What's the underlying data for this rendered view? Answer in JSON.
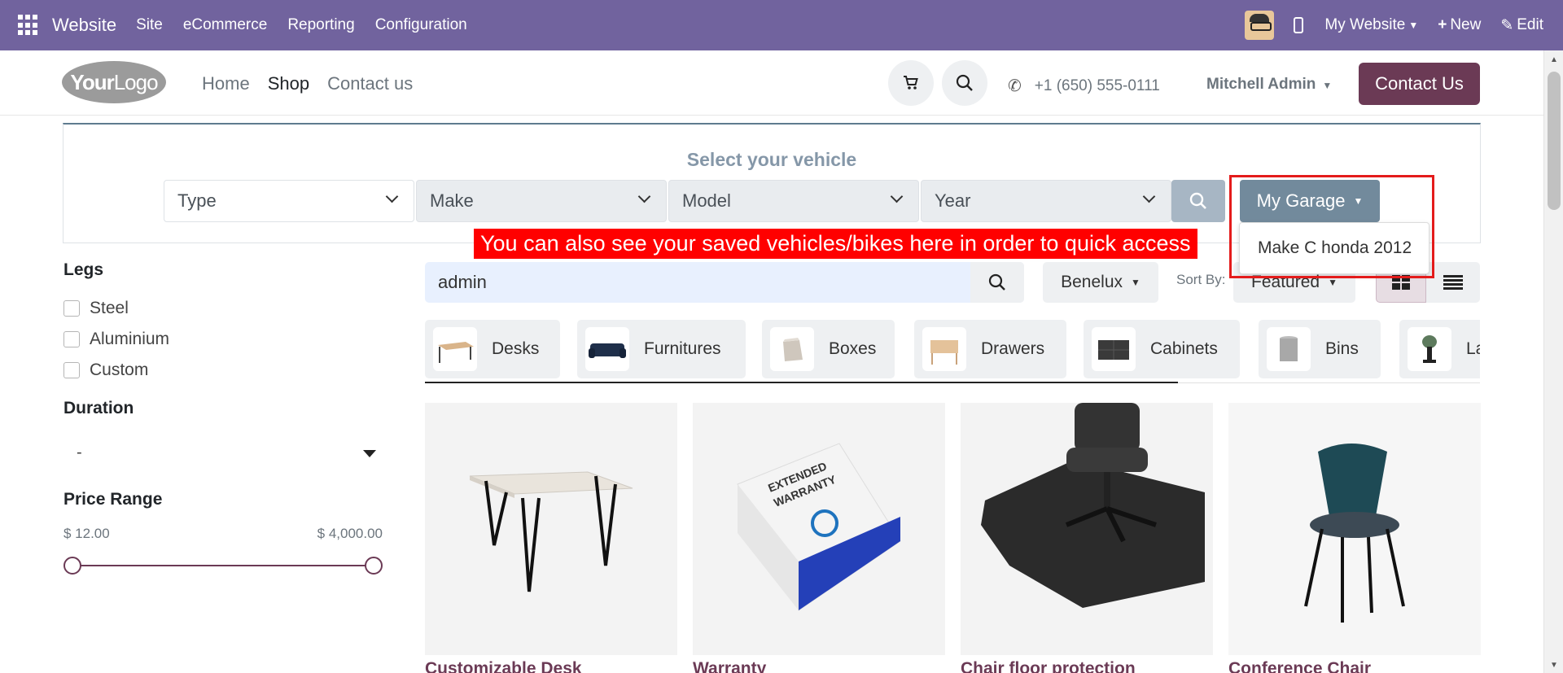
{
  "topbar": {
    "brand": "Website",
    "menu": [
      "Site",
      "eCommerce",
      "Reporting",
      "Configuration"
    ],
    "website_selector": "My Website",
    "new_label": "New",
    "edit_label": "Edit",
    "bg_color": "#71639e"
  },
  "header": {
    "logo_text_bold": "Your",
    "logo_text": "Logo",
    "nav": [
      "Home",
      "Shop",
      "Contact us"
    ],
    "active_nav": "Shop",
    "phone": "+1 (650) 555-0111",
    "user": "Mitchell Admin",
    "contact_button": "Contact Us",
    "accent_color": "#6b3a55"
  },
  "vehicle": {
    "title": "Select your vehicle",
    "selects": [
      "Type",
      "Make",
      "Model",
      "Year"
    ],
    "garage_button": "My Garage",
    "garage_items": [
      "Make C honda 2012"
    ]
  },
  "annotation": {
    "text": "You can also see your saved vehicles/bikes here in order to quick access"
  },
  "filters": {
    "legs_title": "Legs",
    "legs_options": [
      "Steel",
      "Aluminium",
      "Custom"
    ],
    "duration_title": "Duration",
    "duration_value": "-",
    "price_title": "Price Range",
    "price_min": "$ 12.00",
    "price_max": "$ 4,000.00"
  },
  "toolbar": {
    "search_value": "admin",
    "pricelist": "Benelux",
    "sort_label": "Sort By:",
    "sort_value": "Featured"
  },
  "categories": [
    "Desks",
    "Furnitures",
    "Boxes",
    "Drawers",
    "Cabinets",
    "Bins",
    "La"
  ],
  "products": [
    {
      "name": "Customizable Desk"
    },
    {
      "name": "Warranty"
    },
    {
      "name": "Chair floor protection"
    },
    {
      "name": "Conference Chair"
    }
  ],
  "warranty_box_text": [
    "EXTENDED",
    "WARRANTY"
  ]
}
